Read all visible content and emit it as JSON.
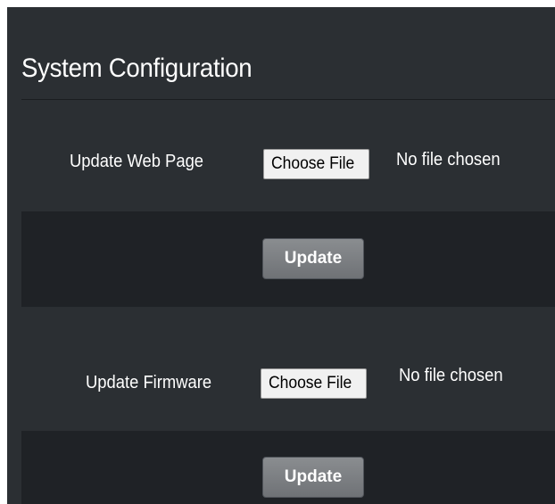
{
  "page": {
    "title": "System Configuration"
  },
  "sections": [
    {
      "label": "Update Web Page",
      "file_button_label": "Choose File",
      "file_status": "No file chosen",
      "update_label": "Update"
    },
    {
      "label": "Update Firmware",
      "file_button_label": "Choose File",
      "file_status": "No file chosen",
      "update_label": "Update"
    }
  ]
}
